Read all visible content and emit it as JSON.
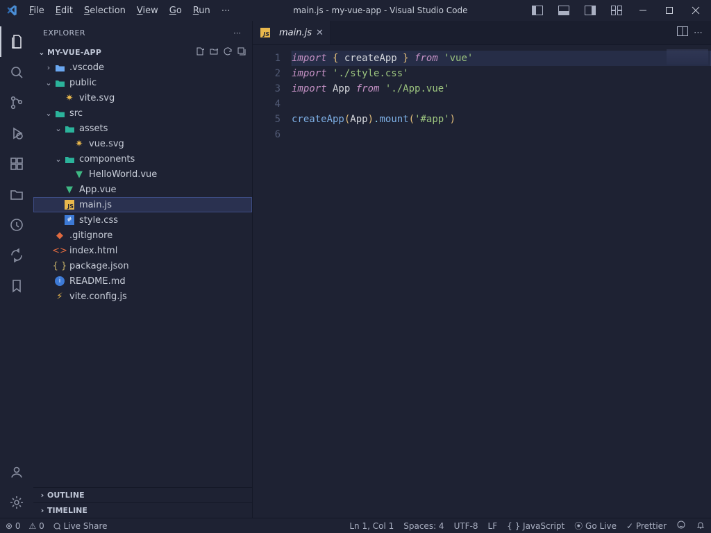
{
  "title": "main.js - my-vue-app - Visual Studio Code",
  "menu": [
    "File",
    "Edit",
    "Selection",
    "View",
    "Go",
    "Run"
  ],
  "menu_ellipsis": "⋯",
  "activity": [
    {
      "name": "explorer",
      "active": true
    },
    {
      "name": "search"
    },
    {
      "name": "source-control"
    },
    {
      "name": "run-debug"
    },
    {
      "name": "extensions"
    },
    {
      "name": "explorer-folders"
    },
    {
      "name": "timeline"
    },
    {
      "name": "forward"
    },
    {
      "name": "bookmark"
    }
  ],
  "activity_bottom": [
    {
      "name": "accounts"
    },
    {
      "name": "settings"
    }
  ],
  "explorer": {
    "title": "EXPLORER",
    "root": "MY-VUE-APP",
    "tree": [
      {
        "indent": 0,
        "chev": "right",
        "icon": "folder-blue",
        "label": ".vscode"
      },
      {
        "indent": 0,
        "chev": "down",
        "icon": "folder-teal",
        "label": "public"
      },
      {
        "indent": 1,
        "chev": "",
        "icon": "sun",
        "label": "vite.svg"
      },
      {
        "indent": 0,
        "chev": "down",
        "icon": "folder-teal",
        "label": "src"
      },
      {
        "indent": 1,
        "chev": "down",
        "icon": "folder-teal",
        "label": "assets"
      },
      {
        "indent": 2,
        "chev": "",
        "icon": "sun",
        "label": "vue.svg"
      },
      {
        "indent": 1,
        "chev": "down",
        "icon": "folder-teal",
        "label": "components"
      },
      {
        "indent": 2,
        "chev": "",
        "icon": "vue",
        "label": "HelloWorld.vue"
      },
      {
        "indent": 1,
        "chev": "",
        "icon": "vue",
        "label": "App.vue"
      },
      {
        "indent": 1,
        "chev": "",
        "icon": "js",
        "label": "main.js",
        "selected": true
      },
      {
        "indent": 1,
        "chev": "",
        "icon": "css",
        "label": "style.css"
      },
      {
        "indent": 0,
        "chev": "",
        "icon": "git",
        "label": ".gitignore"
      },
      {
        "indent": 0,
        "chev": "",
        "icon": "html",
        "label": "index.html"
      },
      {
        "indent": 0,
        "chev": "",
        "icon": "json",
        "label": "package.json"
      },
      {
        "indent": 0,
        "chev": "",
        "icon": "md",
        "label": "README.md"
      },
      {
        "indent": 0,
        "chev": "",
        "icon": "bolt",
        "label": "vite.config.js"
      }
    ],
    "sections": {
      "outline": "OUTLINE",
      "timeline": "TIMELINE"
    }
  },
  "tab": {
    "icon": "js",
    "label": "main.js"
  },
  "editor": {
    "line_numbers": [
      1,
      2,
      3,
      4,
      5,
      6
    ],
    "lines": [
      [
        [
          "k-it",
          "import"
        ],
        [
          "fn",
          " "
        ],
        [
          "pn",
          "{"
        ],
        [
          "fn",
          " createApp "
        ],
        [
          "pn",
          "}"
        ],
        [
          "fn",
          " "
        ],
        [
          "k-it",
          "from"
        ],
        [
          "fn",
          " "
        ],
        [
          "str",
          "'vue'"
        ]
      ],
      [
        [
          "k-it",
          "import"
        ],
        [
          "fn",
          " "
        ],
        [
          "str",
          "'./style.css'"
        ]
      ],
      [
        [
          "k-it",
          "import"
        ],
        [
          "fn",
          " App "
        ],
        [
          "k-it",
          "from"
        ],
        [
          "fn",
          " "
        ],
        [
          "str",
          "'./App.vue'"
        ]
      ],
      [],
      [
        [
          "call",
          "createApp"
        ],
        [
          "pn",
          "("
        ],
        [
          "fn",
          "App"
        ],
        [
          "pn",
          ")"
        ],
        [
          "op",
          "."
        ],
        [
          "call",
          "mount"
        ],
        [
          "pn",
          "("
        ],
        [
          "str",
          "'#app'"
        ],
        [
          "pn",
          ")"
        ]
      ],
      []
    ],
    "highlight_line": 0
  },
  "status": {
    "left": [
      {
        "name": "errors",
        "text": "⊗ 0"
      },
      {
        "name": "warnings",
        "text": "⚠ 0"
      },
      {
        "name": "live-share",
        "text": "Live Share"
      }
    ],
    "right": [
      {
        "name": "cursor",
        "text": "Ln 1, Col 1"
      },
      {
        "name": "spaces",
        "text": "Spaces: 4"
      },
      {
        "name": "encoding",
        "text": "UTF-8"
      },
      {
        "name": "eol",
        "text": "LF"
      },
      {
        "name": "language",
        "text": "{ } JavaScript"
      },
      {
        "name": "go-live",
        "text": "⦿ Go Live"
      },
      {
        "name": "prettier",
        "text": "✓ Prettier"
      },
      {
        "name": "feedback",
        "text": ""
      },
      {
        "name": "bell",
        "text": ""
      }
    ]
  }
}
